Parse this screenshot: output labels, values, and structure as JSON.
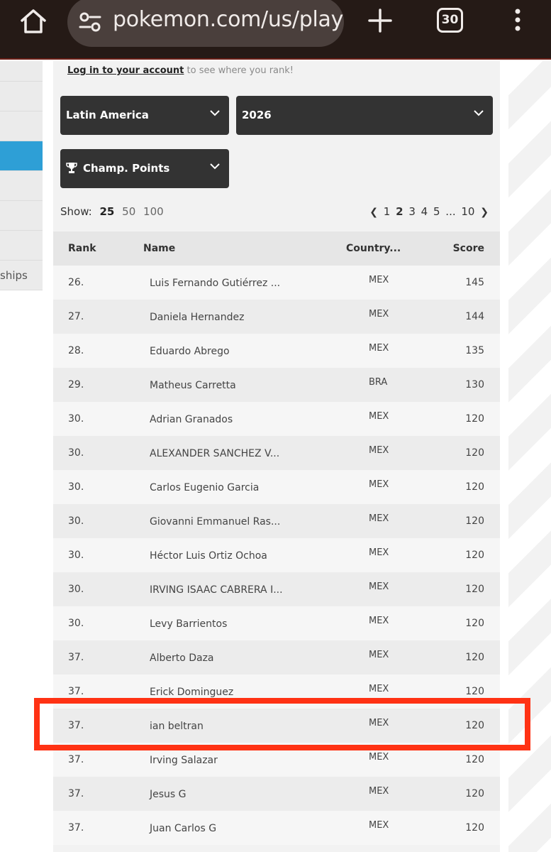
{
  "browser": {
    "url": "pokemon.com/us/play",
    "tab_count": "30"
  },
  "sidebar": {
    "items": [
      "",
      "",
      "",
      "",
      "",
      "",
      "",
      "ships"
    ],
    "active_index": 3
  },
  "login": {
    "link_text": "Log in to your account",
    "suffix": " to see where you rank!"
  },
  "filters": {
    "region": "Latin America",
    "year": "2026",
    "metric": "Champ. Points"
  },
  "show": {
    "label": "Show:",
    "options": [
      "25",
      "50",
      "100"
    ],
    "selected": "25"
  },
  "pagination": {
    "prev": "❮",
    "pages": [
      "1",
      "2",
      "3",
      "4",
      "5"
    ],
    "current": "2",
    "ellipsis": "...",
    "last": "10",
    "next": "❯"
  },
  "table": {
    "headers": {
      "rank": "Rank",
      "name": "Name",
      "country": "Country...",
      "score": "Score"
    },
    "rows": [
      {
        "rank": "26.",
        "name": "Luis Fernando Gutiérrez ...",
        "country": "MEX",
        "score": "145"
      },
      {
        "rank": "27.",
        "name": "Daniela Hernandez",
        "country": "MEX",
        "score": "144"
      },
      {
        "rank": "28.",
        "name": "Eduardo Abrego",
        "country": "MEX",
        "score": "135"
      },
      {
        "rank": "29.",
        "name": "Matheus Carretta",
        "country": "BRA",
        "score": "130"
      },
      {
        "rank": "30.",
        "name": "Adrian Granados",
        "country": "MEX",
        "score": "120"
      },
      {
        "rank": "30.",
        "name": "ALEXANDER SANCHEZ V...",
        "country": "MEX",
        "score": "120"
      },
      {
        "rank": "30.",
        "name": "Carlos Eugenio Garcia",
        "country": "MEX",
        "score": "120"
      },
      {
        "rank": "30.",
        "name": "Giovanni Emmanuel Ras...",
        "country": "MEX",
        "score": "120"
      },
      {
        "rank": "30.",
        "name": "Héctor Luis Ortiz Ochoa",
        "country": "MEX",
        "score": "120"
      },
      {
        "rank": "30.",
        "name": "IRVING ISAAC CABRERA I...",
        "country": "MEX",
        "score": "120"
      },
      {
        "rank": "30.",
        "name": "Levy Barrientos",
        "country": "MEX",
        "score": "120"
      },
      {
        "rank": "37.",
        "name": "Alberto Daza",
        "country": "MEX",
        "score": "120"
      },
      {
        "rank": "37.",
        "name": "Erick Dominguez",
        "country": "MEX",
        "score": "120"
      },
      {
        "rank": "37.",
        "name": "ian beltran",
        "country": "MEX",
        "score": "120"
      },
      {
        "rank": "37.",
        "name": "Irving Salazar",
        "country": "MEX",
        "score": "120"
      },
      {
        "rank": "37.",
        "name": "Jesus G",
        "country": "MEX",
        "score": "120"
      },
      {
        "rank": "37.",
        "name": "Juan Carlos G",
        "country": "MEX",
        "score": "120"
      }
    ]
  },
  "colors": {
    "browser_bar": "#251a16",
    "active_nav": "#2e9fd6",
    "dropdown_bg": "#333333",
    "highlight": "#ff3214"
  }
}
